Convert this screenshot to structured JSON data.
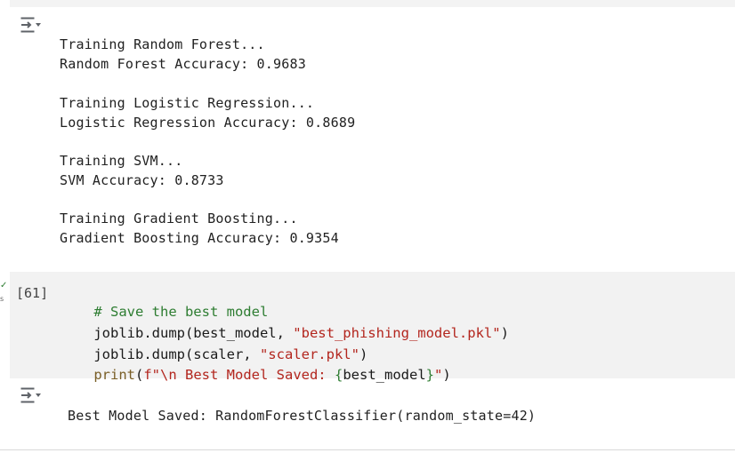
{
  "top_output": {
    "lines": [
      "Training Random Forest...",
      "Random Forest Accuracy: 0.9683",
      "Training Logistic Regression...",
      "Logistic Regression Accuracy: 0.8689",
      "Training SVM...",
      "SVM Accuracy: 0.8733",
      "Training Gradient Boosting...",
      "Gradient Boosting Accuracy: 0.9354"
    ]
  },
  "code_cell": {
    "execution_count": "[61]",
    "status_icon": "check-icon",
    "status_color": "#2e7d32",
    "time_label": "s",
    "line1_comment": "# Save the best model",
    "line2_a": "joblib.dump(best_model, ",
    "line2_str": "\"best_phishing_model.pkl\"",
    "line2_b": ")",
    "line3_a": "joblib.dump(scaler, ",
    "line3_str": "\"scaler.pkl\"",
    "line3_b": ")",
    "line4_print": "print",
    "line4_open": "(",
    "line4_str1": "f\"\\n Best Model Saved: ",
    "line4_brace_open": "{",
    "line4_var": "best_model",
    "line4_brace_close": "}",
    "line4_str2": "\"",
    "line4_close": ")"
  },
  "bottom_output": {
    "line": "Best Model Saved: RandomForestClassifier(random_state=42)"
  },
  "icons": {
    "output_toggle": "output-toggle-icon"
  }
}
